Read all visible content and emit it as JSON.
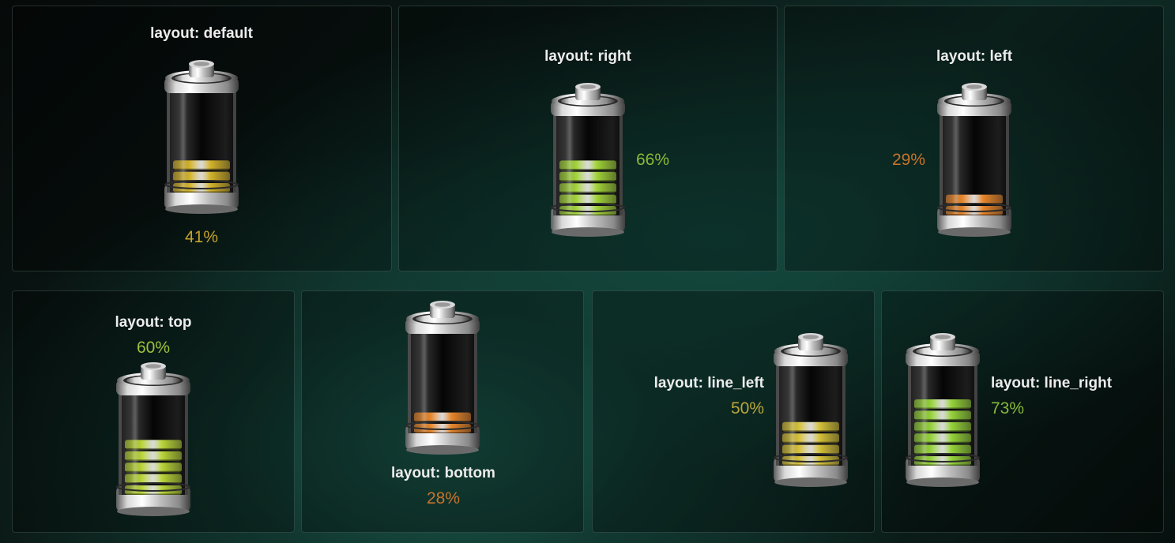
{
  "cards": [
    {
      "title": "layout: default",
      "percent": "41%",
      "level": 41,
      "color": "#d4b42c",
      "pct_color": "#c6a32b"
    },
    {
      "title": "layout: right",
      "percent": "66%",
      "level": 66,
      "color": "#a3d43a",
      "pct_color": "#8bb83a"
    },
    {
      "title": "layout: left",
      "percent": "29%",
      "level": 29,
      "color": "#e8872c",
      "pct_color": "#c7742c"
    },
    {
      "title": "layout: top",
      "percent": "60%",
      "level": 60,
      "color": "#b9d638",
      "pct_color": "#9cc13a"
    },
    {
      "title": "layout: bottom",
      "percent": "28%",
      "level": 28,
      "color": "#e8872c",
      "pct_color": "#c7742c"
    },
    {
      "title": "layout: line_left",
      "percent": "50%",
      "level": 50,
      "color": "#d6c23a",
      "pct_color": "#b9a73a"
    },
    {
      "title": "layout: line_right",
      "percent": "73%",
      "level": 73,
      "color": "#96d43a",
      "pct_color": "#86b83a"
    }
  ]
}
